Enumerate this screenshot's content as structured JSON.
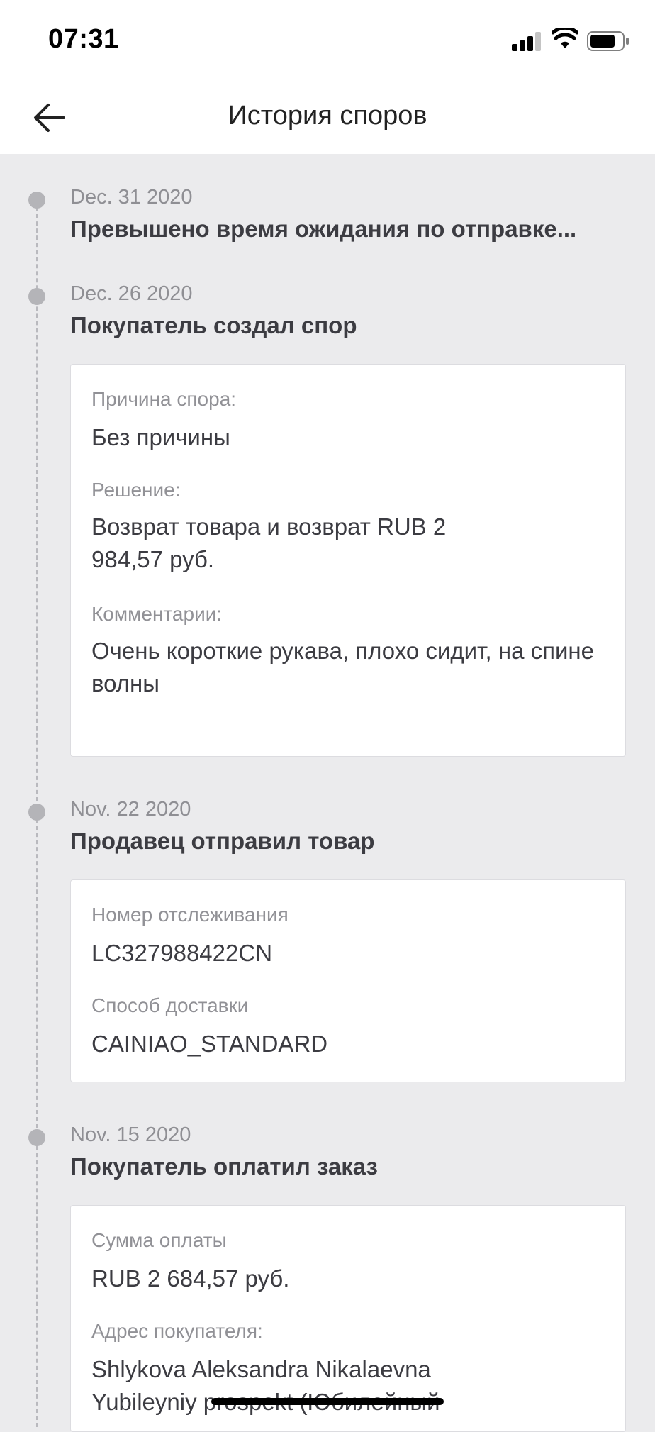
{
  "status_bar": {
    "time": "07:31"
  },
  "header": {
    "title": "История споров"
  },
  "events": [
    {
      "date": "Dec. 31 2020",
      "title": "Превышено время ожидания по отправке..."
    },
    {
      "date": "Dec. 26 2020",
      "title": "Покупатель создал спор",
      "fields": [
        {
          "label": "Причина спора:",
          "value": "Без причины"
        },
        {
          "label": "Решение:",
          "value": "Возврат товара и возврат RUB 2 984,57 руб."
        },
        {
          "label": "Комментарии:",
          "value": "Очень короткие рукава, плохо сидит, на спине волны"
        }
      ]
    },
    {
      "date": "Nov. 22 2020",
      "title": "Продавец отправил товар",
      "fields": [
        {
          "label": "Номер отслеживания",
          "value": "LC327988422CN"
        },
        {
          "label": "Способ доставки",
          "value": "CAINIAO_STANDARD"
        }
      ]
    },
    {
      "date": "Nov. 15 2020",
      "title": "Покупатель оплатил заказ",
      "fields": [
        {
          "label": "Сумма оплаты",
          "value": "RUB 2 684,57 руб."
        },
        {
          "label": "Адрес покупателя:",
          "value": "Shlykova Aleksandra Nikalaevna Yubileyniy prospekt (Юбилейный"
        }
      ]
    }
  ],
  "icons": {
    "back": "arrow-left-icon",
    "signal": "cellular-signal-icon",
    "wifi": "wifi-icon",
    "battery": "battery-icon"
  },
  "colors": {
    "background": "#ebebed",
    "card": "#ffffff",
    "timeline_dot": "#b4b4b8",
    "text_primary": "#3c3c42",
    "text_secondary": "#919196"
  }
}
